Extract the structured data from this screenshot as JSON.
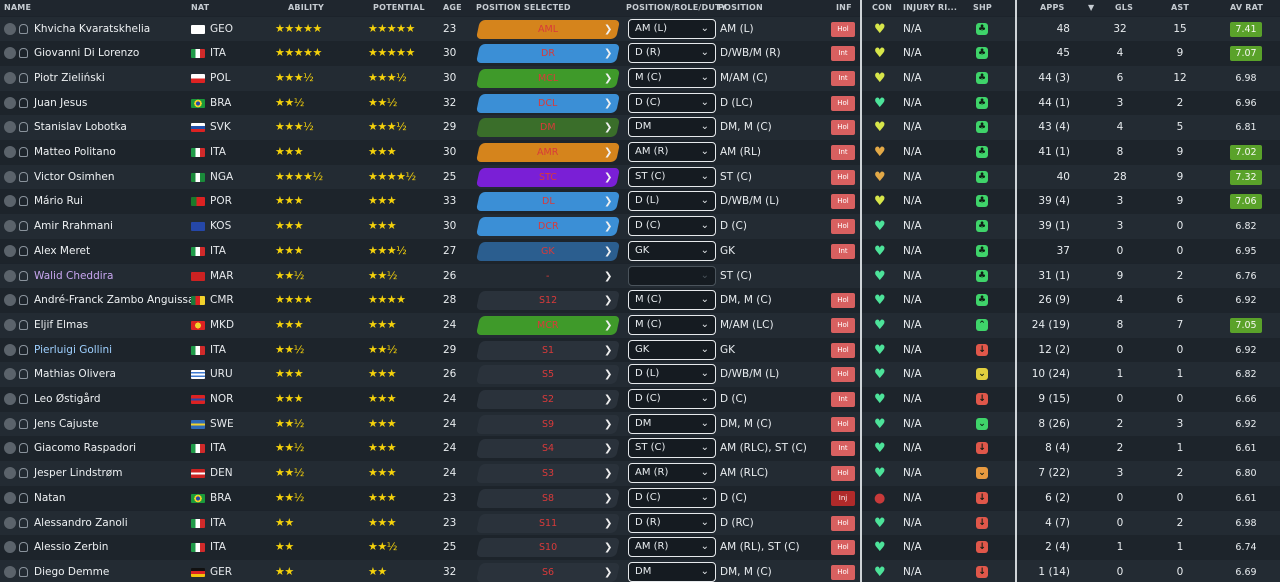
{
  "headers": {
    "name": "NAME",
    "nat": "NAT",
    "ability": "ABILITY",
    "potential": "POTENTIAL",
    "age": "AGE",
    "pos_selected": "POSITION SELECTED",
    "role_duty": "POSITION/ROLE/DUTY",
    "position": "POSITION",
    "inf": "INF",
    "con": "CON",
    "injury": "INJURY RI...",
    "shp": "SHP",
    "apps": "APPS",
    "sort_arrow": "▼",
    "gls": "GLS",
    "ast": "AST",
    "av_rat": "AV RAT"
  },
  "colors": {
    "orange": "#d5841c",
    "blue": "#3b8fd6",
    "green": "#3f9a2a",
    "dkgreen": "#3a6e2a",
    "purple": "#7a1fd6",
    "navy": "#2b5e8f",
    "slate": "#2a323b",
    "shp_green": "#3fd46a",
    "shp_red": "#e0574a",
    "shp_orange": "#e89a40",
    "shp_yellow": "#e0cf3e"
  },
  "rows": [
    {
      "name": "Khvicha Kvaratskhelia",
      "flag": "geo",
      "nat": "GEO",
      "ability": "★★★★★",
      "potential": "★★★★★",
      "age": "23",
      "pos_sel": "AML",
      "pos_color": "orange",
      "role": "AM (L)",
      "position": "AM (L)",
      "inf": "Hol",
      "con": "♥",
      "con_tone": "yellow",
      "injury": "N/A",
      "shp": "♣",
      "shp_tone": "shp_green",
      "apps": "48",
      "gls": "32",
      "ast": "15",
      "avrat": "7.41",
      "good": true
    },
    {
      "name": "Giovanni Di Lorenzo",
      "flag": "ita",
      "nat": "ITA",
      "ability": "★★★★★",
      "potential": "★★★★★",
      "age": "30",
      "pos_sel": "DR",
      "pos_color": "blue",
      "role": "D (R)",
      "position": "D/WB/M (R)",
      "inf": "Int",
      "con": "♥",
      "con_tone": "yellow",
      "injury": "N/A",
      "shp": "♣",
      "shp_tone": "shp_green",
      "apps": "45",
      "gls": "4",
      "ast": "9",
      "avrat": "7.07",
      "good": true
    },
    {
      "name": "Piotr Zieliński",
      "flag": "pol",
      "nat": "POL",
      "ability": "★★★½",
      "potential": "★★★½",
      "age": "30",
      "pos_sel": "MCL",
      "pos_color": "green",
      "role": "M (C)",
      "position": "M/AM (C)",
      "inf": "Int",
      "con": "♥",
      "con_tone": "yellow",
      "injury": "N/A",
      "shp": "♣",
      "shp_tone": "shp_green",
      "apps": "44 (3)",
      "gls": "6",
      "ast": "12",
      "avrat": "6.98",
      "good": false
    },
    {
      "name": "Juan Jesus",
      "flag": "bra",
      "nat": "BRA",
      "ability": "★★½",
      "potential": "★★½",
      "age": "32",
      "pos_sel": "DCL",
      "pos_color": "blue",
      "role": "D (C)",
      "position": "D (LC)",
      "inf": "Hol",
      "con": "♥",
      "con_tone": "green",
      "injury": "N/A",
      "shp": "♣",
      "shp_tone": "shp_green",
      "apps": "44 (1)",
      "gls": "3",
      "ast": "2",
      "avrat": "6.96",
      "good": false
    },
    {
      "name": "Stanislav Lobotka",
      "flag": "svk",
      "nat": "SVK",
      "ability": "★★★½",
      "potential": "★★★½",
      "age": "29",
      "pos_sel": "DM",
      "pos_color": "dkgreen",
      "role": "DM",
      "position": "DM, M (C)",
      "inf": "Hol",
      "con": "♥",
      "con_tone": "yellow",
      "injury": "N/A",
      "shp": "♣",
      "shp_tone": "shp_green",
      "apps": "43 (4)",
      "gls": "4",
      "ast": "5",
      "avrat": "6.81",
      "good": false
    },
    {
      "name": "Matteo Politano",
      "flag": "ita",
      "nat": "ITA",
      "ability": "★★★",
      "potential": "★★★",
      "age": "30",
      "pos_sel": "AMR",
      "pos_color": "orange",
      "role": "AM (R)",
      "position": "AM (RL)",
      "inf": "Int",
      "con": "♥",
      "con_tone": "orange",
      "injury": "N/A",
      "shp": "♣",
      "shp_tone": "shp_green",
      "apps": "41 (1)",
      "gls": "8",
      "ast": "9",
      "avrat": "7.02",
      "good": true
    },
    {
      "name": "Victor Osimhen",
      "flag": "nga",
      "nat": "NGA",
      "ability": "★★★★½",
      "potential": "★★★★½",
      "age": "25",
      "pos_sel": "STC",
      "pos_color": "purple",
      "role": "ST (C)",
      "position": "ST (C)",
      "inf": "Hol",
      "con": "♥",
      "con_tone": "orange",
      "injury": "N/A",
      "shp": "♣",
      "shp_tone": "shp_green",
      "apps": "40",
      "gls": "28",
      "ast": "9",
      "avrat": "7.32",
      "good": true
    },
    {
      "name": "Mário Rui",
      "flag": "por",
      "nat": "POR",
      "ability": "★★★",
      "potential": "★★★",
      "age": "33",
      "pos_sel": "DL",
      "pos_color": "blue",
      "role": "D (L)",
      "position": "D/WB/M (L)",
      "inf": "Hol",
      "con": "♥",
      "con_tone": "yellow",
      "injury": "N/A",
      "shp": "♣",
      "shp_tone": "shp_green",
      "apps": "39 (4)",
      "gls": "3",
      "ast": "9",
      "avrat": "7.06",
      "good": true
    },
    {
      "name": "Amir Rrahmani",
      "flag": "kos",
      "nat": "KOS",
      "ability": "★★★",
      "potential": "★★★",
      "age": "30",
      "pos_sel": "DCR",
      "pos_color": "blue",
      "role": "D (C)",
      "position": "D (C)",
      "inf": "Hol",
      "con": "♥",
      "con_tone": "green",
      "injury": "N/A",
      "shp": "♣",
      "shp_tone": "shp_green",
      "apps": "39 (1)",
      "gls": "3",
      "ast": "0",
      "avrat": "6.82",
      "good": false
    },
    {
      "name": "Alex Meret",
      "flag": "ita",
      "nat": "ITA",
      "ability": "★★★",
      "potential": "★★★½",
      "age": "27",
      "pos_sel": "GK",
      "pos_color": "navy",
      "role": "GK",
      "position": "GK",
      "inf": "Int",
      "con": "♥",
      "con_tone": "green",
      "injury": "N/A",
      "shp": "♣",
      "shp_tone": "shp_green",
      "apps": "37",
      "gls": "0",
      "ast": "0",
      "avrat": "6.95",
      "good": false
    },
    {
      "name": "Walid Cheddira",
      "flag": "mar",
      "nat": "MAR",
      "ability": "★★½",
      "potential": "★★½",
      "age": "26",
      "pos_sel": "-",
      "pos_color": "none",
      "role": "",
      "position": "ST (C)",
      "inf": "",
      "con": "♥",
      "con_tone": "green",
      "injury": "N/A",
      "shp": "♣",
      "shp_tone": "shp_green",
      "apps": "31 (1)",
      "gls": "9",
      "ast": "2",
      "avrat": "6.76",
      "good": false,
      "name_tone": "purple"
    },
    {
      "name": "André-Franck Zambo Anguissa",
      "flag": "cmr",
      "nat": "CMR",
      "ability": "★★★★",
      "potential": "★★★★",
      "age": "28",
      "pos_sel": "S12",
      "pos_color": "slate",
      "role": "M (C)",
      "position": "DM, M (C)",
      "inf": "Hol",
      "con": "♥",
      "con_tone": "green",
      "injury": "N/A",
      "shp": "♣",
      "shp_tone": "shp_green",
      "apps": "26 (9)",
      "gls": "4",
      "ast": "6",
      "avrat": "6.92",
      "good": false
    },
    {
      "name": "Eljif Elmas",
      "flag": "mkd",
      "nat": "MKD",
      "ability": "★★★",
      "potential": "★★★",
      "age": "24",
      "pos_sel": "MCR",
      "pos_color": "green",
      "role": "M (C)",
      "position": "M/AM (LC)",
      "inf": "Hol",
      "con": "♥",
      "con_tone": "green",
      "injury": "N/A",
      "shp": "⌃",
      "shp_tone": "shp_green",
      "apps": "24 (19)",
      "gls": "8",
      "ast": "7",
      "avrat": "7.05",
      "good": true
    },
    {
      "name": "Pierluigi Gollini",
      "flag": "ita",
      "nat": "ITA",
      "ability": "★★½",
      "potential": "★★½",
      "age": "29",
      "pos_sel": "S1",
      "pos_color": "slate",
      "role": "GK",
      "position": "GK",
      "inf": "Hol",
      "con": "♥",
      "con_tone": "green",
      "injury": "N/A",
      "shp": "↓",
      "shp_tone": "shp_red",
      "apps": "12 (2)",
      "gls": "0",
      "ast": "0",
      "avrat": "6.92",
      "good": false,
      "name_tone": "blue"
    },
    {
      "name": "Mathias Olivera",
      "flag": "uru",
      "nat": "URU",
      "ability": "★★★",
      "potential": "★★★",
      "age": "26",
      "pos_sel": "S5",
      "pos_color": "slate",
      "role": "D (L)",
      "position": "D/WB/M (L)",
      "inf": "Hol",
      "con": "♥",
      "con_tone": "green",
      "injury": "N/A",
      "shp": "⌄",
      "shp_tone": "shp_yellow",
      "apps": "10 (24)",
      "gls": "1",
      "ast": "1",
      "avrat": "6.82",
      "good": false
    },
    {
      "name": "Leo Østigård",
      "flag": "nor",
      "nat": "NOR",
      "ability": "★★★",
      "potential": "★★★",
      "age": "24",
      "pos_sel": "S2",
      "pos_color": "slate",
      "role": "D (C)",
      "position": "D (C)",
      "inf": "Int",
      "con": "♥",
      "con_tone": "green",
      "injury": "N/A",
      "shp": "↓",
      "shp_tone": "shp_red",
      "apps": "9 (15)",
      "gls": "0",
      "ast": "0",
      "avrat": "6.66",
      "good": false
    },
    {
      "name": "Jens Cajuste",
      "flag": "swe",
      "nat": "SWE",
      "ability": "★★½",
      "potential": "★★★",
      "age": "24",
      "pos_sel": "S9",
      "pos_color": "slate",
      "role": "DM",
      "position": "DM, M (C)",
      "inf": "Hol",
      "con": "♥",
      "con_tone": "green",
      "injury": "N/A",
      "shp": "⌄",
      "shp_tone": "shp_green",
      "apps": "8 (26)",
      "gls": "2",
      "ast": "3",
      "avrat": "6.92",
      "good": false
    },
    {
      "name": "Giacomo Raspadori",
      "flag": "ita",
      "nat": "ITA",
      "ability": "★★½",
      "potential": "★★★",
      "age": "24",
      "pos_sel": "S4",
      "pos_color": "slate",
      "role": "ST (C)",
      "position": "AM (RLC), ST (C)",
      "inf": "Int",
      "con": "♥",
      "con_tone": "green",
      "injury": "N/A",
      "shp": "↓",
      "shp_tone": "shp_red",
      "apps": "8 (4)",
      "gls": "2",
      "ast": "1",
      "avrat": "6.61",
      "good": false
    },
    {
      "name": "Jesper Lindstrøm",
      "flag": "den",
      "nat": "DEN",
      "ability": "★★½",
      "potential": "★★★",
      "age": "24",
      "pos_sel": "S3",
      "pos_color": "slate",
      "role": "AM (R)",
      "position": "AM (RLC)",
      "inf": "Hol",
      "con": "♥",
      "con_tone": "green",
      "injury": "N/A",
      "shp": "⌄",
      "shp_tone": "shp_orange",
      "apps": "7 (22)",
      "gls": "3",
      "ast": "2",
      "avrat": "6.80",
      "good": false
    },
    {
      "name": "Natan",
      "flag": "bra",
      "nat": "BRA",
      "ability": "★★½",
      "potential": "★★★",
      "age": "23",
      "pos_sel": "S8",
      "pos_color": "slate",
      "role": "D (C)",
      "position": "D (C)",
      "inf": "Inj",
      "con": "●",
      "con_tone": "red",
      "injury": "N/A",
      "shp": "↓",
      "shp_tone": "shp_red",
      "apps": "6 (2)",
      "gls": "0",
      "ast": "0",
      "avrat": "6.61",
      "good": false
    },
    {
      "name": "Alessandro Zanoli",
      "flag": "ita",
      "nat": "ITA",
      "ability": "★★",
      "potential": "★★★",
      "age": "23",
      "pos_sel": "S11",
      "pos_color": "slate",
      "role": "D (R)",
      "position": "D (RC)",
      "inf": "Hol",
      "con": "♥",
      "con_tone": "green",
      "injury": "N/A",
      "shp": "↓",
      "shp_tone": "shp_red",
      "apps": "4 (7)",
      "gls": "0",
      "ast": "2",
      "avrat": "6.98",
      "good": false
    },
    {
      "name": "Alessio Zerbin",
      "flag": "ita",
      "nat": "ITA",
      "ability": "★★",
      "potential": "★★½",
      "age": "25",
      "pos_sel": "S10",
      "pos_color": "slate",
      "role": "AM (R)",
      "position": "AM (RL), ST (C)",
      "inf": "Hol",
      "con": "♥",
      "con_tone": "green",
      "injury": "N/A",
      "shp": "↓",
      "shp_tone": "shp_red",
      "apps": "2 (4)",
      "gls": "1",
      "ast": "1",
      "avrat": "6.74",
      "good": false
    },
    {
      "name": "Diego Demme",
      "flag": "ger",
      "nat": "GER",
      "ability": "★★",
      "potential": "★★",
      "age": "32",
      "pos_sel": "S6",
      "pos_color": "slate",
      "role": "DM",
      "position": "DM, M (C)",
      "inf": "Hol",
      "con": "♥",
      "con_tone": "green",
      "injury": "N/A",
      "shp": "↓",
      "shp_tone": "shp_red",
      "apps": "1 (14)",
      "gls": "0",
      "ast": "0",
      "avrat": "6.69",
      "good": false
    }
  ]
}
